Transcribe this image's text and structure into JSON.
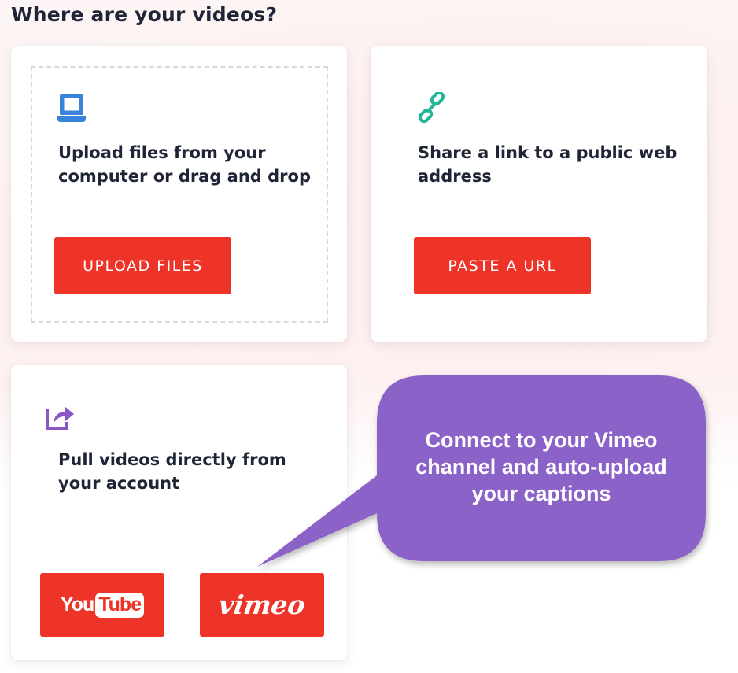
{
  "page": {
    "title": "Where are your videos?"
  },
  "upload_card": {
    "icon": "laptop-icon",
    "description": "Upload files from your\ncomputer or drag and drop",
    "button_label": "UPLOAD FILES"
  },
  "link_card": {
    "icon": "link-icon",
    "description": "Share a link to a public web\naddress",
    "button_label": "PASTE A URL"
  },
  "pull_card": {
    "icon": "share-icon",
    "description": "Pull videos directly from\nyour account",
    "youtube": {
      "you": "You",
      "tube": "Tube"
    },
    "vimeo_label": "vimeo"
  },
  "callout": {
    "text": "Connect to your Vimeo\nchannel and auto-upload\nyour captions"
  },
  "colors": {
    "accent": "#ee3328",
    "callout": "#8b62c8",
    "laptop_icon": "#3b82db",
    "link_icon": "#23b79a",
    "share_icon": "#8a56c4",
    "text": "#1f2536"
  }
}
